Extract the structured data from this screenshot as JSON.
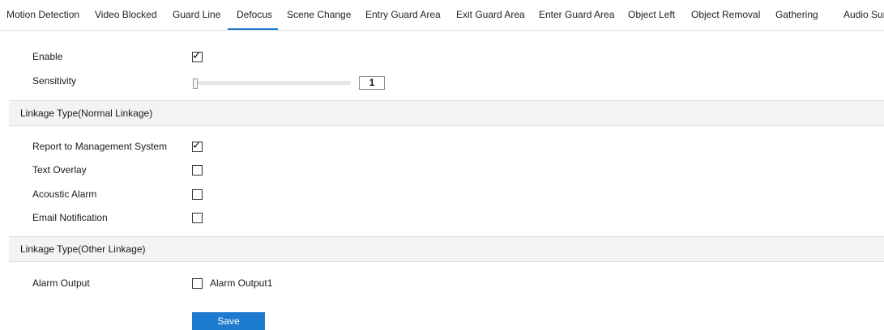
{
  "tabs": [
    {
      "label": "Motion Detection",
      "active": false
    },
    {
      "label": "Video Blocked",
      "active": false
    },
    {
      "label": "Guard Line",
      "active": false
    },
    {
      "label": "Defocus",
      "active": true
    },
    {
      "label": "Scene Change",
      "active": false
    },
    {
      "label": "Entry Guard Area",
      "active": false
    },
    {
      "label": "Exit Guard Area",
      "active": false
    },
    {
      "label": "Enter Guard Area",
      "active": false
    },
    {
      "label": "Object Left",
      "active": false
    },
    {
      "label": "Object Removal",
      "active": false
    },
    {
      "label": "Gathering",
      "active": false
    },
    {
      "label": "Audio Surge",
      "active": false
    }
  ],
  "settings": {
    "enable": {
      "label": "Enable",
      "checked": true
    },
    "sensitivity": {
      "label": "Sensitivity",
      "value": "1",
      "min": 1,
      "max": 100
    }
  },
  "normal_linkage": {
    "title": "Linkage Type(Normal Linkage)",
    "items": [
      {
        "label": "Report to Management System",
        "checked": true
      },
      {
        "label": "Text Overlay",
        "checked": false
      },
      {
        "label": "Acoustic Alarm",
        "checked": false
      },
      {
        "label": "Email Notification",
        "checked": false
      }
    ]
  },
  "other_linkage": {
    "title": "Linkage Type(Other Linkage)",
    "alarm_output": {
      "label": "Alarm Output",
      "option_label": "Alarm Output1",
      "checked": false
    }
  },
  "save_label": "Save",
  "colors": {
    "accent": "#1e7cd0",
    "section_bg": "#f3f3f3"
  }
}
